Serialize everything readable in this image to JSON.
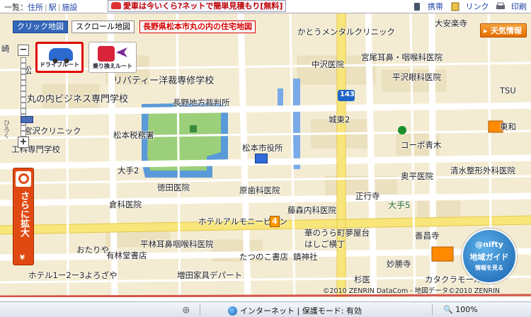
{
  "topbar": {
    "list_label": "一覧：",
    "links": [
      "住所",
      "駅",
      "施設"
    ],
    "promo": "愛車は今いくら?ネットで簡単見積もり[無料]",
    "right": {
      "mobile": "携帯",
      "link": "リンク",
      "print": "印刷"
    }
  },
  "map": {
    "tabs": {
      "click_map": "クリック地図",
      "scroll_map": "スクロール地図"
    },
    "title": "長野県松本市丸の内の住宅地図",
    "weather": "天気情報",
    "route": {
      "drive": "ドライブルート",
      "transit": "乗り換えルート"
    },
    "zoom": {
      "plus": "+",
      "minus": "−"
    },
    "side_text": "ひろく",
    "search": {
      "text": "さらに拡大",
      "yen": "¥"
    },
    "nifty": {
      "line1": "@nifty",
      "line2": "地域ガイド",
      "line3": "情報を見る"
    },
    "route_number": "143",
    "marker_number": "4",
    "copyright": "©2010 ZENRIN DataCom - 地図データ©2010 ZENRIN",
    "labels": [
      {
        "id": "kato-mental",
        "text": "かとうメンタルクリニック"
      },
      {
        "id": "daianji",
        "text": "大安楽寺"
      },
      {
        "id": "miyao",
        "text": "宮尾耳鼻・咽喉科医院"
      },
      {
        "id": "nakazawa",
        "text": "中沢医院"
      },
      {
        "id": "hirasawa",
        "text": "平沢眼科医院"
      },
      {
        "id": "liberty",
        "text": "リバティー洋裁専修学校"
      },
      {
        "id": "marunouchi-biz",
        "text": "丸の内ビジネス専門学校"
      },
      {
        "id": "nagano-court",
        "text": "長野地方裁判所"
      },
      {
        "id": "miyazawa",
        "text": "宮沢クリニック"
      },
      {
        "id": "tax-office",
        "text": "松本税務署"
      },
      {
        "id": "kogyo",
        "text": "工科専門学校"
      },
      {
        "id": "jotoh2",
        "text": "城東2"
      },
      {
        "id": "kohbe",
        "text": "コーポ青木"
      },
      {
        "id": "tsu",
        "text": "TSU"
      },
      {
        "id": "higashiwa",
        "text": "東和"
      },
      {
        "id": "city-office",
        "text": "松本市役所"
      },
      {
        "id": "ote2",
        "text": "大手2"
      },
      {
        "id": "tokuda",
        "text": "徳田医院"
      },
      {
        "id": "haraya",
        "text": "原歯科医院"
      },
      {
        "id": "okui",
        "text": "奥平医院"
      },
      {
        "id": "shimizu",
        "text": "清水整形外科医院"
      },
      {
        "id": "kura",
        "text": "倉科医院"
      },
      {
        "id": "shogyo",
        "text": "正行寺"
      },
      {
        "id": "ote5",
        "text": "大手5"
      },
      {
        "id": "fujimori",
        "text": "藤森内科医院"
      },
      {
        "id": "hotel-alm",
        "text": "ホテルアルモニービアン"
      },
      {
        "id": "hiraoka",
        "text": "平林耳鼻咽喉科医院"
      },
      {
        "id": "hananoura",
        "text": "華のうら町夢屋台"
      },
      {
        "id": "hashigo",
        "text": "はしご横丁"
      },
      {
        "id": "zenryo",
        "text": "善昌寺"
      },
      {
        "id": "otari",
        "text": "おたりや"
      },
      {
        "id": "arimori",
        "text": "有林堂書店"
      },
      {
        "id": "tatsunoko",
        "text": "たつのこ書店"
      },
      {
        "id": "chinjin",
        "text": "鎮神社"
      },
      {
        "id": "myosho",
        "text": "妙勝寺"
      },
      {
        "id": "hotel12",
        "text": "ホテル1ー2ー3よろざや"
      },
      {
        "id": "masuda",
        "text": "増田家具デパート"
      },
      {
        "id": "catacola",
        "text": "カタクラモール"
      },
      {
        "id": "sugi",
        "text": "杉医"
      },
      {
        "id": "matsu",
        "text": "松"
      },
      {
        "id": "sumi",
        "text": "崎"
      }
    ]
  },
  "statusbar": {
    "zone": "インターネット | 保護モード: 有効",
    "zoom": "100%"
  }
}
